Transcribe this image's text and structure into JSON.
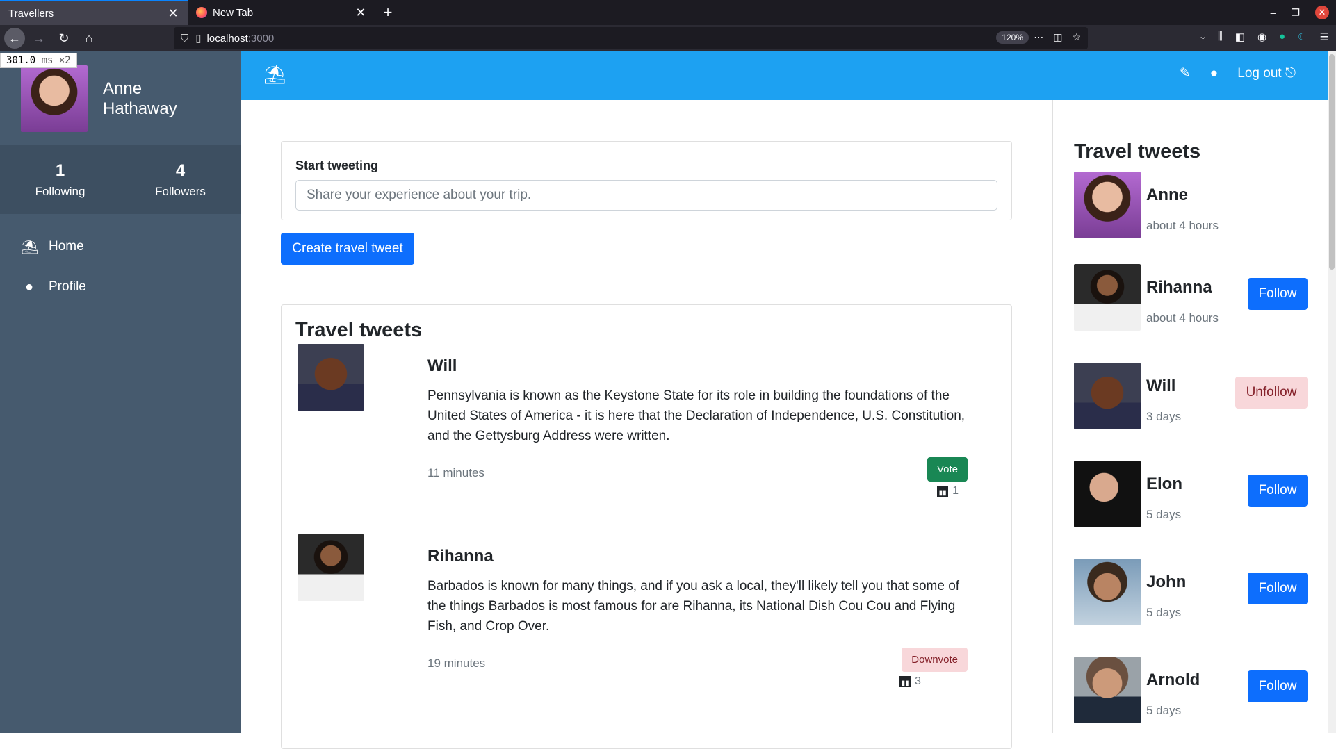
{
  "browser": {
    "tabs": [
      {
        "title": "Travellers"
      },
      {
        "title": "New Tab"
      }
    ],
    "url_host": "localhost",
    "url_port": ":3000",
    "zoom": "120%",
    "timing_value": "301.0",
    "timing_unit": "ms ×2"
  },
  "sidebar": {
    "user_name": "Anne Hathaway",
    "following_count": "1",
    "following_label": "Following",
    "followers_count": "4",
    "followers_label": "Followers",
    "nav": [
      {
        "label": "Home",
        "icon": "umbrella-beach-icon"
      },
      {
        "label": "Profile",
        "icon": "user-circle-icon"
      }
    ]
  },
  "topbar": {
    "logo_icon": "umbrella-beach-icon",
    "logout_label": "Log out"
  },
  "compose": {
    "label": "Start tweeting",
    "placeholder": "Share your experience about your trip.",
    "button_label": "Create travel tweet"
  },
  "feed": {
    "title": "Travel tweets",
    "posts": [
      {
        "author": "Will",
        "body": "Pennsylvania is known as the Keystone State for its role in building the foundations of the United States of America - it is here that the Declaration of Independence, U.S. Constitution, and the Gettysburg Address were written.",
        "time": "11 minutes",
        "vote_label": "Vote",
        "votes": "1"
      },
      {
        "author": "Rihanna",
        "body": "Barbados is known for many things, and if you ask a local, they'll likely tell you that some of the things Barbados is most famous for are Rihanna, its National Dish Cou Cou and Flying Fish, and Crop Over.",
        "time": "19 minutes",
        "vote_label": "Downvote",
        "votes": "3"
      }
    ]
  },
  "right_sidebar": {
    "title": "Travel tweets",
    "users": [
      {
        "name": "Anne",
        "time": "about 4 hours",
        "button": ""
      },
      {
        "name": "Rihanna",
        "time": "about 4 hours",
        "button": "Follow"
      },
      {
        "name": "Will",
        "time": "3 days",
        "button": "Unfollow"
      },
      {
        "name": "Elon",
        "time": "5 days",
        "button": "Follow"
      },
      {
        "name": "John",
        "time": "5 days",
        "button": "Follow"
      },
      {
        "name": "Arnold",
        "time": "5 days",
        "button": "Follow"
      }
    ]
  },
  "colors": {
    "topbar": "#1da1f2",
    "sidebar": "#465a6e",
    "primary": "#0d6efd",
    "success": "#198754",
    "danger_light": "#f8d7da"
  }
}
